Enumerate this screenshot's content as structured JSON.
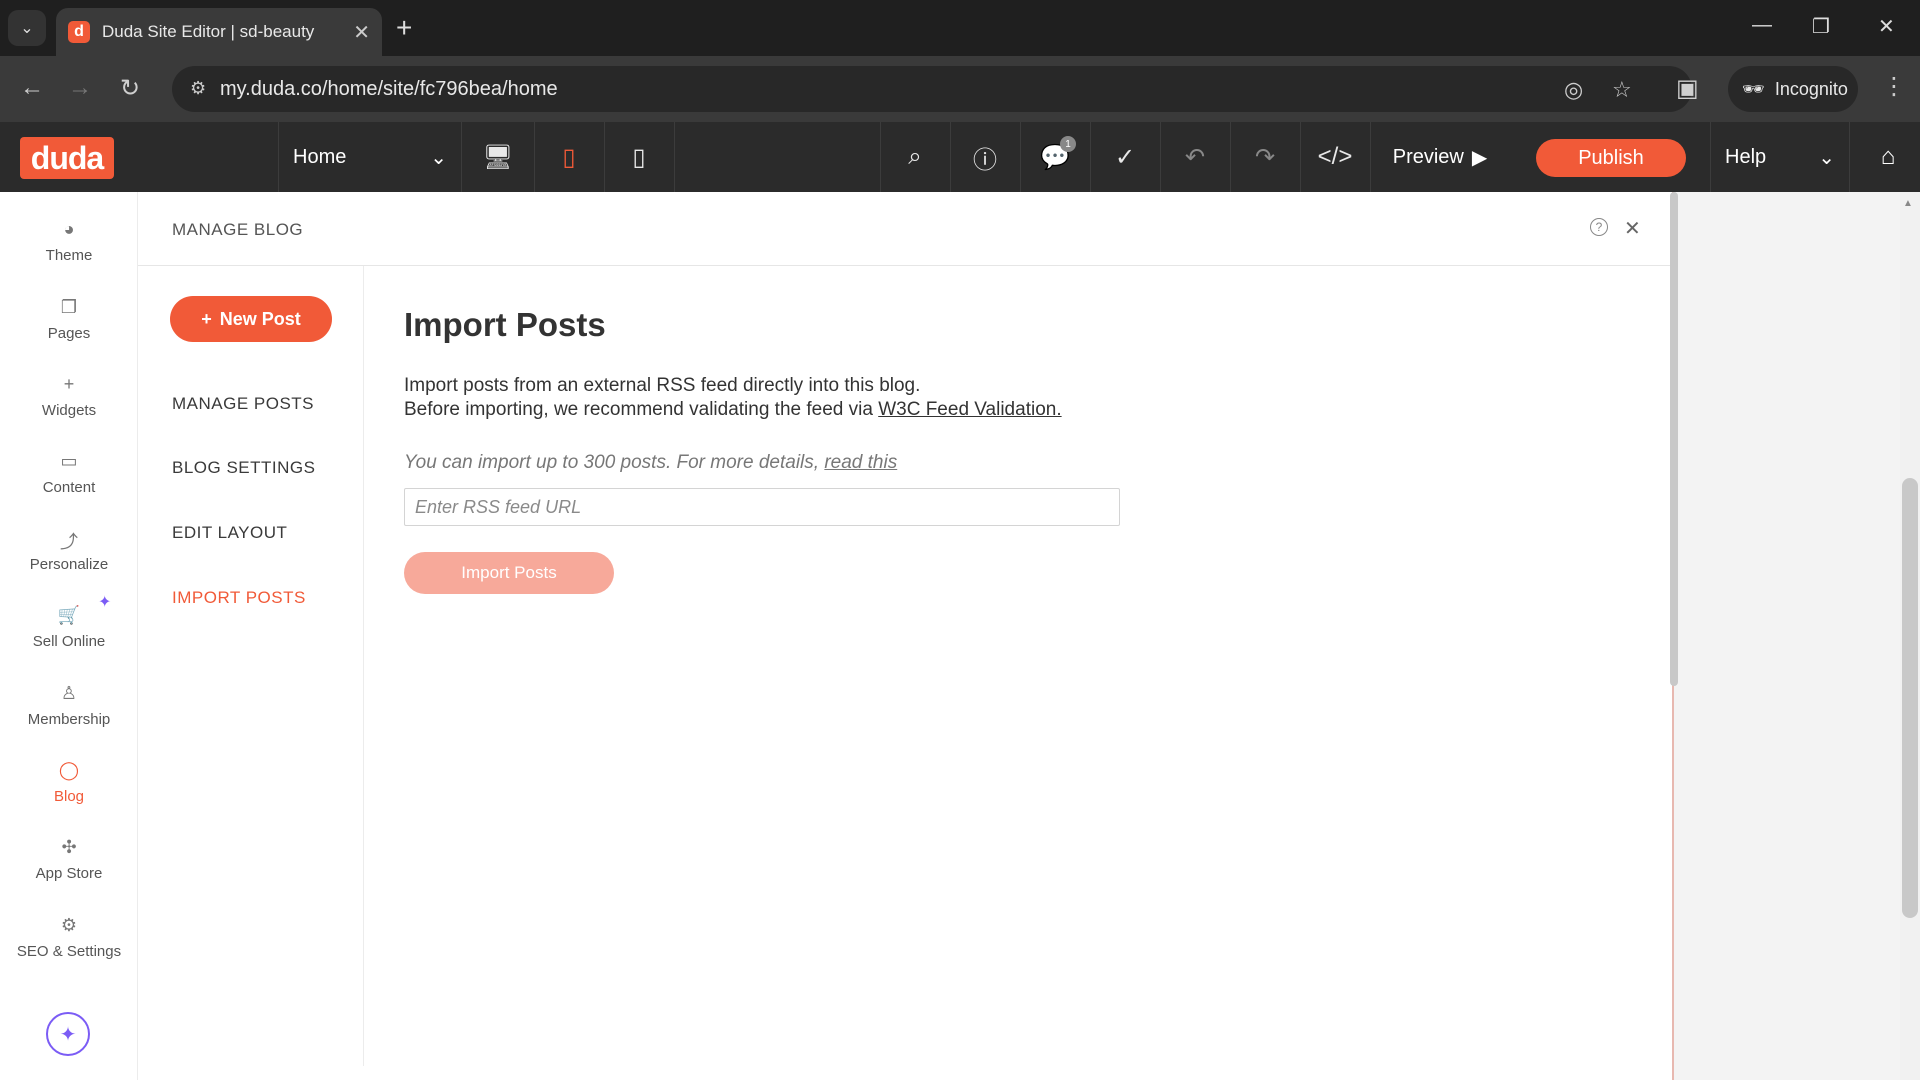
{
  "browser": {
    "tab_title": "Duda Site Editor | sd-beauty",
    "favicon_letter": "d",
    "url": "my.duda.co/home/site/fc796bea/home",
    "incognito_label": "Incognito"
  },
  "editor": {
    "logo": "duda",
    "page_selector": "Home",
    "comments_badge": "1",
    "preview_label": "Preview",
    "publish_label": "Publish",
    "help_label": "Help",
    "accent_color": "#f15a38"
  },
  "sidebar": {
    "items": [
      {
        "label": "Theme",
        "icon": "palette-icon"
      },
      {
        "label": "Pages",
        "icon": "pages-icon"
      },
      {
        "label": "Widgets",
        "icon": "plus-icon"
      },
      {
        "label": "Content",
        "icon": "folder-icon"
      },
      {
        "label": "Personalize",
        "icon": "personalize-icon"
      },
      {
        "label": "Sell Online",
        "icon": "cart-icon"
      },
      {
        "label": "Membership",
        "icon": "person-icon"
      },
      {
        "label": "Blog",
        "icon": "chat-bubble-icon"
      },
      {
        "label": "App Store",
        "icon": "puzzle-icon"
      },
      {
        "label": "SEO & Settings",
        "icon": "gear-icon"
      }
    ],
    "active": "Blog"
  },
  "panel": {
    "title": "MANAGE BLOG",
    "new_post_label": "New Post",
    "nav": [
      "MANAGE POSTS",
      "BLOG SETTINGS",
      "EDIT LAYOUT",
      "IMPORT POSTS"
    ],
    "active_nav": "IMPORT POSTS",
    "import": {
      "heading": "Import Posts",
      "line1": "Import posts from an external RSS feed directly into this blog.",
      "line2": "Before importing, we recommend validating the feed via",
      "link": "W3C Feed Validation.",
      "note": "You can import up to 300 posts. For more details,",
      "note_link": "read this",
      "input_placeholder": "Enter RSS feed URL",
      "input_value": "",
      "button_label": "Import Posts"
    }
  }
}
